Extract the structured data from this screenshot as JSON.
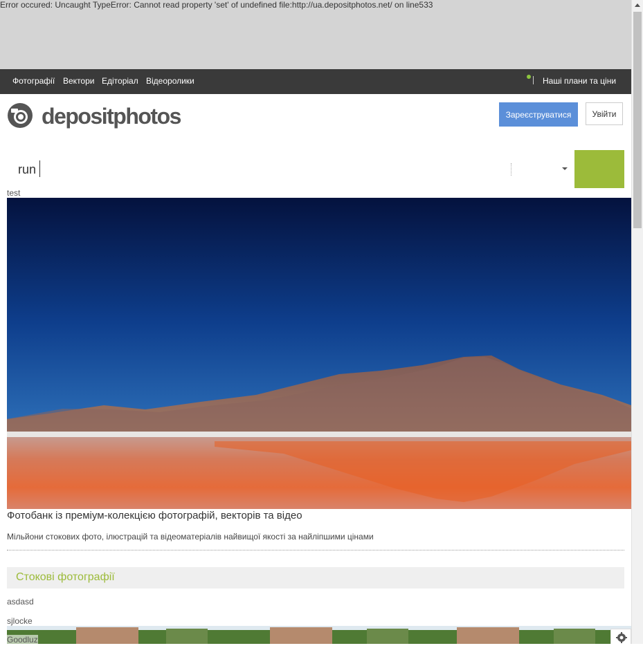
{
  "error": {
    "message": "Error occured: Uncaught TypeError: Cannot read property 'set' of undefined file:http://ua.depositphotos.net/ on line533"
  },
  "topnav": {
    "items": [
      {
        "label": "Фотографії"
      },
      {
        "label": "Вектори"
      },
      {
        "label": "Едіторіал"
      },
      {
        "label": "Відеоролики"
      }
    ],
    "plans_label": "Наші плани та ціни"
  },
  "header": {
    "logo_text": "depositphotos",
    "register_label": "Зареєструватися",
    "login_label": "Увійти"
  },
  "search": {
    "value": "run"
  },
  "banner": {
    "label": "test",
    "title": "Фотобанк із преміум-колекцією фотографій, векторів та відео",
    "subtitle": "Мільйони стокових фото, ілюстрацій та відеоматеріалів найвищої якості за найліпшими цінами"
  },
  "section": {
    "title": "Стокові фотографії",
    "author1": "asdasd",
    "author2": "sjlocke",
    "author3": "Goodluz"
  },
  "colors": {
    "accent_green": "#9cbb3a",
    "button_blue": "#5b8fd9",
    "nav_dark": "#3a3a3a"
  },
  "icons": {
    "camera": "camera-logo-icon",
    "dropdown": "chevron-down-icon",
    "gear": "gear-icon"
  }
}
